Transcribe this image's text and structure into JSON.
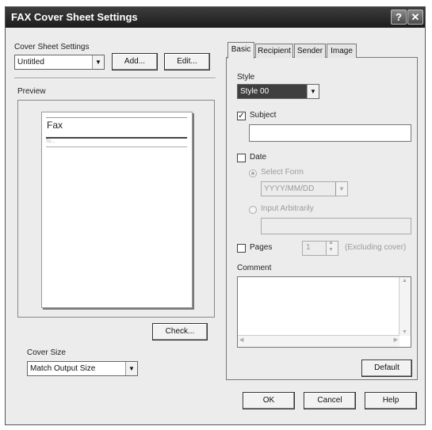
{
  "window": {
    "title": "FAX Cover Sheet Settings",
    "help_glyph": "?",
    "close_glyph": "✕"
  },
  "left": {
    "cover_sheet_label": "Cover Sheet Settings",
    "cover_sheet_value": "Untitled",
    "add_label": "Add...",
    "edit_label": "Edit...",
    "preview_label": "Preview",
    "preview_fax_title": "Fax",
    "preview_small_text": "To...",
    "check_label": "Check...",
    "cover_size_label": "Cover Size",
    "cover_size_value": "Match Output Size"
  },
  "tabs": [
    {
      "label": "Basic",
      "active": true
    },
    {
      "label": "Recipient",
      "active": false
    },
    {
      "label": "Sender",
      "active": false
    },
    {
      "label": "Image",
      "active": false
    }
  ],
  "basic": {
    "style_label": "Style",
    "style_value": "Style 00",
    "subject_label": "Subject",
    "subject_checked": true,
    "subject_value": "",
    "date_label": "Date",
    "date_checked": false,
    "select_form_label": "Select Form",
    "date_format_value": "YYYY/MM/DD",
    "input_arbitrarily_label": "Input Arbitrarily",
    "pages_label": "Pages",
    "pages_checked": false,
    "pages_value": "1",
    "pages_note": "(Excluding cover)",
    "comment_label": "Comment",
    "default_label": "Default"
  },
  "footer": {
    "ok_label": "OK",
    "cancel_label": "Cancel",
    "help_label": "Help"
  }
}
